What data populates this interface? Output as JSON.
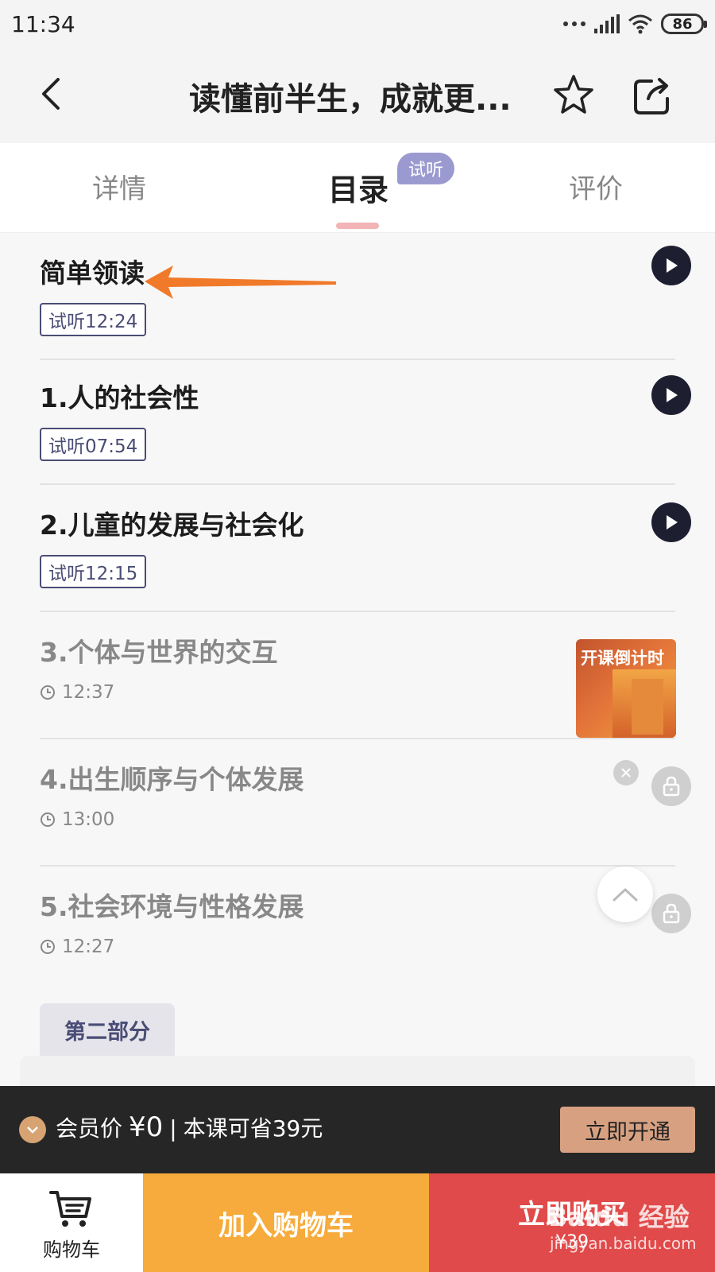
{
  "status_bar": {
    "time": "11:34",
    "battery": "86"
  },
  "header": {
    "title": "读懂前半生，成就更..."
  },
  "tabs": [
    {
      "label": "详情"
    },
    {
      "label": "目录",
      "badge": "试听"
    },
    {
      "label": "评价"
    }
  ],
  "lessons": [
    {
      "title": "简单领读",
      "tag": "试听12:24",
      "locked": false
    },
    {
      "title": "1.人的社会性",
      "tag": "试听07:54",
      "locked": false
    },
    {
      "title": "2.儿童的发展与社会化",
      "tag": "试听12:15",
      "locked": false
    },
    {
      "title": "3.个体与世界的交互",
      "duration": "12:37",
      "locked": true
    },
    {
      "title": "4.出生顺序与个体发展",
      "duration": "13:00",
      "locked": true
    },
    {
      "title": "5.社会环境与性格发展",
      "duration": "12:27",
      "locked": true
    }
  ],
  "promo": {
    "label": "开课倒计时"
  },
  "section": {
    "label": "第二部分"
  },
  "member_bar": {
    "label": "会员价",
    "price": "¥0",
    "separator": "|",
    "saving": "本课可省39元",
    "open_button": "立即开通"
  },
  "bottom": {
    "cart_label": "购物车",
    "add_cart": "加入购物车",
    "buy_now": "立即购买",
    "price": "¥39"
  },
  "watermark": {
    "brand": "Baidu 经验",
    "url": "jingyan.baidu.com"
  },
  "colors": {
    "accent_dark": "#1d1f31",
    "tag_navy": "#4a4d75",
    "badge_purple": "#9b9ad0",
    "add_cart_orange": "#f6ab3c",
    "buy_red": "#e14a4a",
    "member_gold": "#d7a181",
    "annotation_arrow": "#f07a2a"
  }
}
